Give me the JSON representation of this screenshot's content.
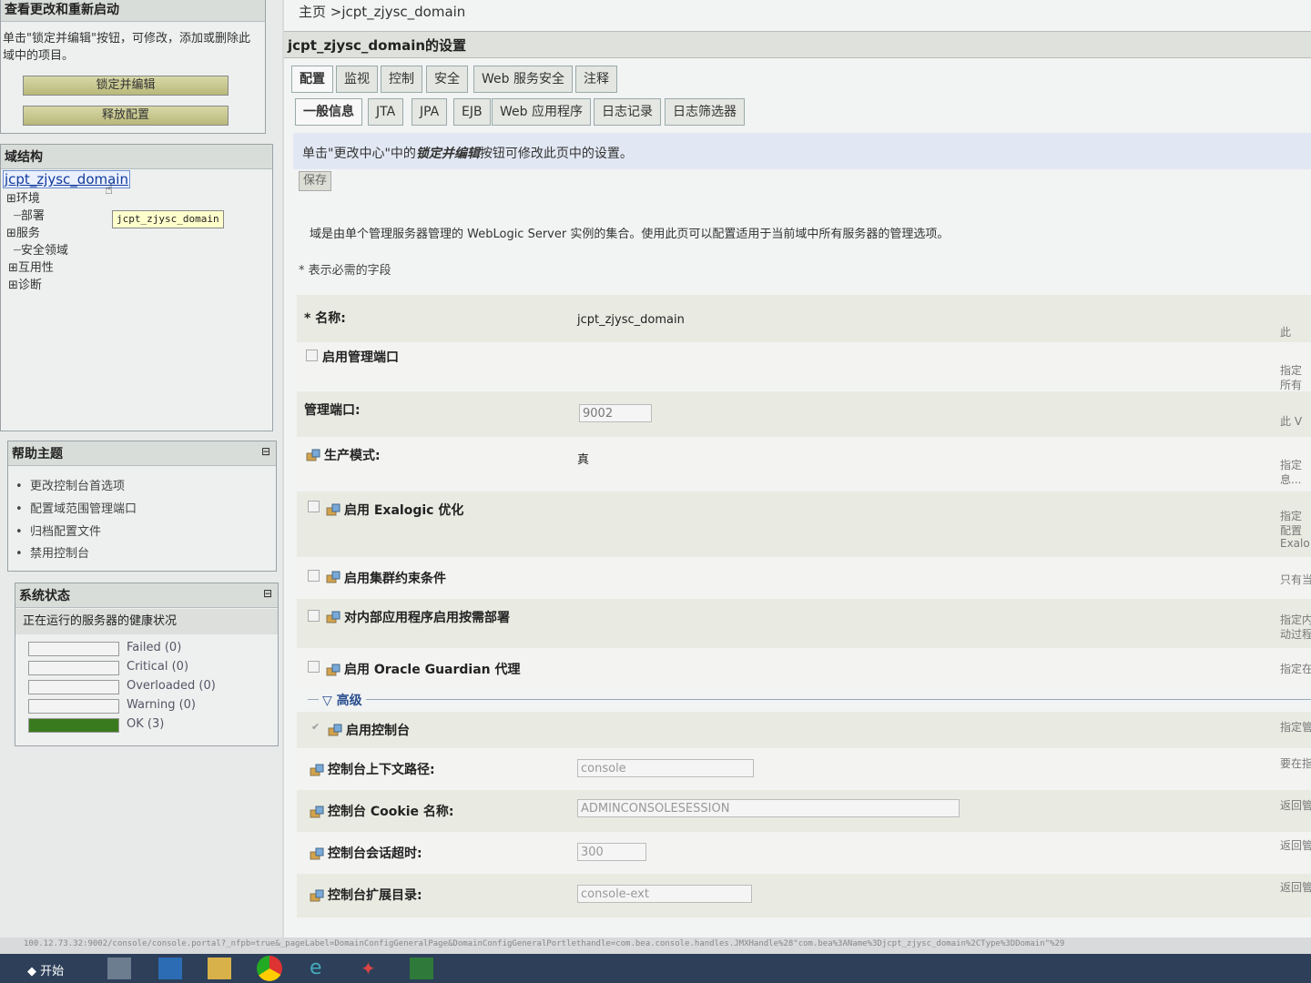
{
  "change_center": {
    "title": "查看更改和重新启动",
    "desc": "单击\"锁定并编辑\"按钮，可修改，添加或删除此域中的项目。",
    "lock_button": "锁定并编辑",
    "release_button": "释放配置"
  },
  "domain_structure": {
    "title": "域结构",
    "root": "jcpt_zjysc_domain",
    "tooltip": "jcpt_zjysc_domain",
    "items": [
      "环境",
      "部署",
      "服务",
      "安全领域",
      "互用性",
      "诊断"
    ]
  },
  "help": {
    "title": "帮助主题",
    "items": [
      "更改控制台首选项",
      "配置域范围管理端口",
      "归档配置文件",
      "禁用控制台"
    ]
  },
  "system_status": {
    "title": "系统状态",
    "subtitle": "正在运行的服务器的健康状况",
    "rows": [
      {
        "label": "Failed (0)",
        "fill": 0,
        "color": "#b33"
      },
      {
        "label": "Critical (0)",
        "fill": 0,
        "color": "#c60"
      },
      {
        "label": "Overloaded (0)",
        "fill": 0,
        "color": "#c90"
      },
      {
        "label": "Warning (0)",
        "fill": 0,
        "color": "#cc0"
      },
      {
        "label": "OK (3)",
        "fill": 1,
        "color": "#3a7a1e"
      }
    ]
  },
  "breadcrumb": "主页 >jcpt_zjysc_domain",
  "page_title": "jcpt_zjysc_domain的设置",
  "tabs": [
    "配置",
    "监视",
    "控制",
    "安全",
    "Web 服务安全",
    "注释"
  ],
  "subtabs": [
    "一般信息",
    "JTA",
    "JPA",
    "EJB",
    "Web 应用程序",
    "日志记录",
    "日志筛选器"
  ],
  "notice": {
    "prefix": "单击\"更改中心\"中的",
    "bold": "锁定并编辑",
    "suffix": "按钮可修改此页中的设置。"
  },
  "save_button": "保存",
  "description": "域是由单个管理服务器管理的 WebLogic Server 实例的集合。使用此页可以配置适用于当前域中所有服务器的管理选项。",
  "required_note": "* 表示必需的字段",
  "fields": {
    "name_label": "* 名称:",
    "name_value": "jcpt_zjysc_domain",
    "admin_port_enable": "启用管理端口",
    "admin_port_label": "管理端口:",
    "admin_port_value": "9002",
    "prod_mode_label": "生产模式:",
    "prod_mode_value": "真",
    "exalogic": "启用 Exalogic 优化",
    "cluster": "启用集群约束条件",
    "on_demand": "对内部应用程序启用按需部署",
    "guardian": "启用 Oracle Guardian 代理",
    "advanced": "高级",
    "console_enabled": "启用控制台",
    "context_path_label": "控制台上下文路径:",
    "context_path_value": "console",
    "cookie_label": "控制台 Cookie 名称:",
    "cookie_value": "ADMINCONSOLESESSION",
    "timeout_label": "控制台会话超时:",
    "timeout_value": "300",
    "ext_dir_label": "控制台扩展目录:",
    "ext_dir_value": "console-ext"
  },
  "right_cut": [
    "此",
    "指定",
    "所有",
    "此 V",
    "指定",
    "息...",
    "指定",
    "配置",
    "Exalo",
    "只有当",
    "指定内",
    "动过程",
    "指定在",
    "指定管",
    "要在指",
    "返回管",
    "返回管",
    "返回管"
  ],
  "status_url": "100.12.73.32:9002/console/console.portal?_nfpb=true&_pageLabel=DomainConfigGeneralPage&DomainConfigGeneralPortlethandle=com.bea.console.handles.JMXHandle%28\"com.bea%3AName%3Djcpt_zjysc_domain%2CType%3DDomain\"%29",
  "taskbar_start": "开始"
}
